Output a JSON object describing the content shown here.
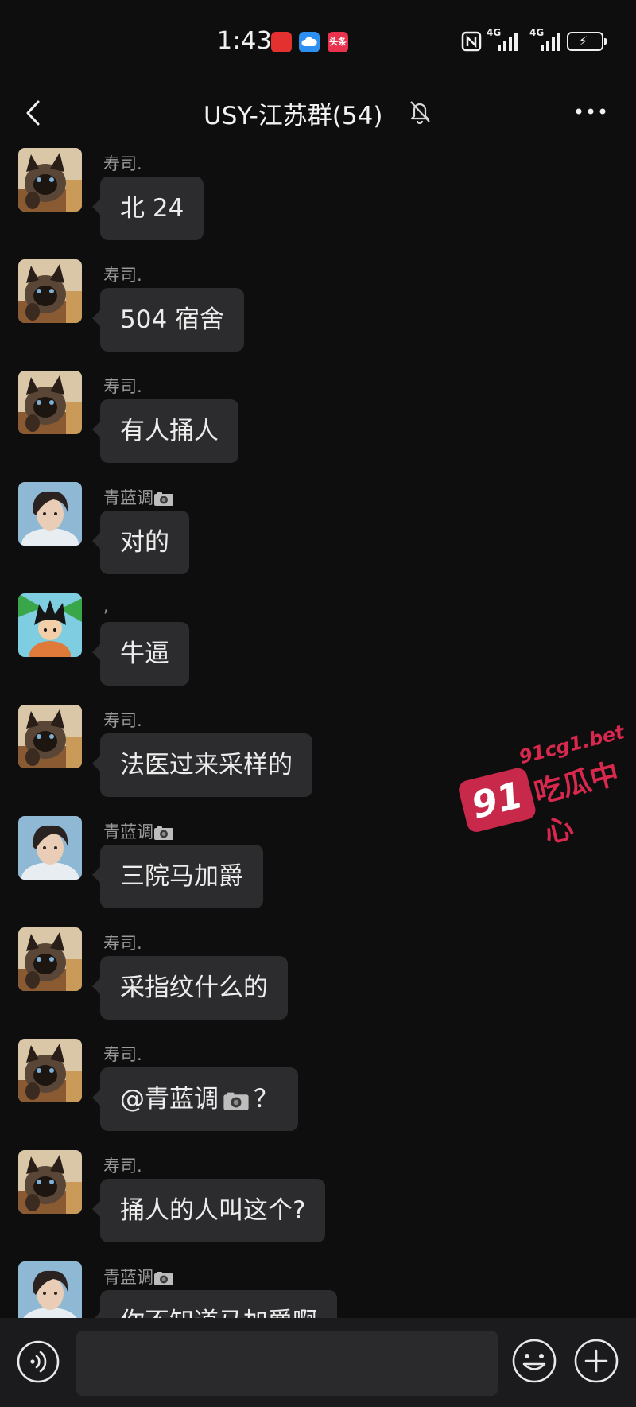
{
  "status_bar": {
    "time": "1:43",
    "notification_badge_text": "头条",
    "network_1": "4G",
    "network_2": "4G"
  },
  "header": {
    "title": "USY-江苏群(54)",
    "back_icon": "chevron-left-icon",
    "mute_icon": "bell-off-icon",
    "more_icon": "more-horizontal-icon"
  },
  "messages": [
    {
      "sender": "寿司.",
      "text": "北 24",
      "avatar": "siamese-cat"
    },
    {
      "sender": "寿司.",
      "text": "504 宿舍",
      "avatar": "siamese-cat"
    },
    {
      "sender": "寿司.",
      "text": "有人捅人",
      "avatar": "siamese-cat"
    },
    {
      "sender": "青蓝调",
      "text": "对的",
      "avatar": "portrait"
    },
    {
      "sender": ",",
      "text": "牛逼",
      "avatar": "cartoon-boy"
    },
    {
      "sender": "寿司.",
      "text": "法医过来采样的",
      "avatar": "siamese-cat"
    },
    {
      "sender": "青蓝调",
      "text": "三院马加爵",
      "avatar": "portrait"
    },
    {
      "sender": "寿司.",
      "text": "采指纹什么的",
      "avatar": "siamese-cat"
    },
    {
      "sender": "寿司.",
      "text": "@青蓝调",
      "text_suffix": "？",
      "avatar": "siamese-cat"
    },
    {
      "sender": "寿司.",
      "text": "捅人的人叫这个?",
      "avatar": "siamese-cat"
    },
    {
      "sender": "青蓝调",
      "text": "你不知道马加爵啊",
      "avatar": "portrait"
    }
  ],
  "watermark": {
    "badge": "91",
    "site": "91cg1.bet",
    "name": "吃瓜中心"
  },
  "input_bar": {
    "voice_icon": "voice-icon",
    "emoji_icon": "emoji-icon",
    "plus_icon": "plus-icon",
    "placeholder": ""
  },
  "colors": {
    "background": "#0e0e0f",
    "bubble": "#2c2c2e",
    "sender_text": "#9a9a9a",
    "watermark": "#c8284a"
  }
}
